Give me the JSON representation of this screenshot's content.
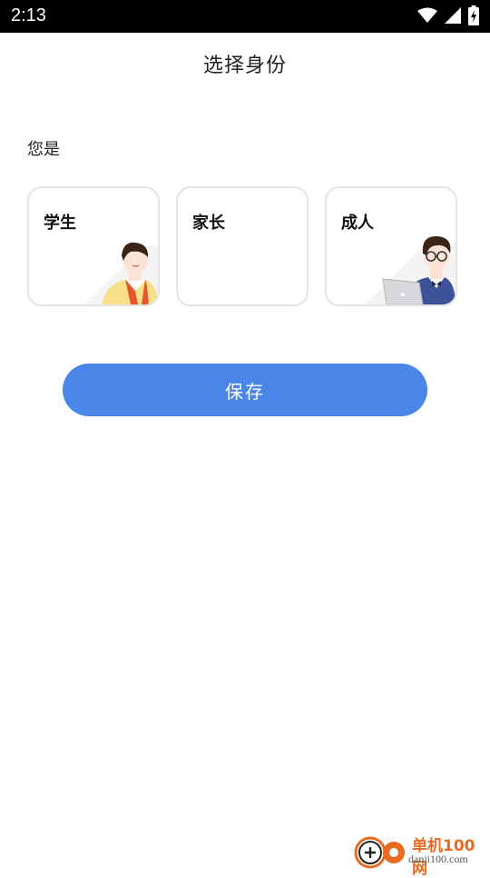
{
  "status_bar": {
    "time": "2:13",
    "icons": [
      "wifi-icon",
      "cellular-signal-icon",
      "battery-charging-icon"
    ]
  },
  "header": {
    "title": "选择身份"
  },
  "section": {
    "label": "您是"
  },
  "roles": [
    {
      "label": "学生",
      "illustration": "student-illustration"
    },
    {
      "label": "家长",
      "illustration": ""
    },
    {
      "label": "成人",
      "illustration": "adult-illustration"
    }
  ],
  "actions": {
    "save_label": "保存"
  },
  "watermark": {
    "brand": "单机100网",
    "domain": "danji100.com"
  },
  "colors": {
    "primary": "#4a86e8",
    "card_border": "#e4e4e4",
    "status_bg": "#000000",
    "watermark": "#e96a21"
  }
}
